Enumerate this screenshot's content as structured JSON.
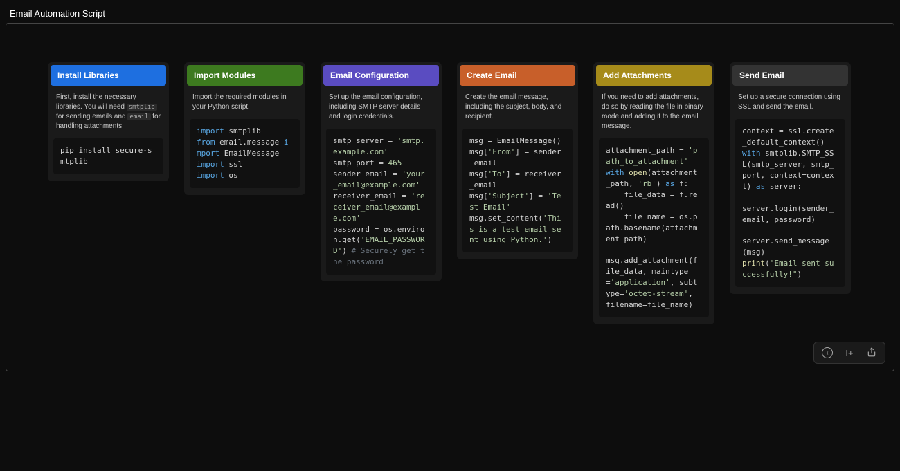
{
  "page_title": "Email Automation Script",
  "cards": [
    {
      "header_class": "hdr-blue",
      "title": "Install Libraries",
      "desc_html": "First, install the necessary libraries. You will need <code>smtplib</code> for sending emails and <code>email</code> for handling attachments.",
      "code_html": "pip install secure-smtplib"
    },
    {
      "header_class": "hdr-green",
      "title": "Import Modules",
      "desc_html": "Import the required modules in your Python script.",
      "code_html": "<span class=\"tok-kw\">import</span> smtplib\n<span class=\"tok-kw\">from</span> email.message <span class=\"tok-kw\">import</span> EmailMessage\n<span class=\"tok-kw\">import</span> ssl\n<span class=\"tok-kw\">import</span> os"
    },
    {
      "header_class": "hdr-purple",
      "title": "Email Configuration",
      "desc_html": "Set up the email configuration, including SMTP server details and login credentials.",
      "code_html": "smtp_server = <span class=\"tok-str\">'smtp.example.com'</span>\nsmtp_port = <span class=\"tok-num\">465</span>\nsender_email = <span class=\"tok-str\">'your_email@example.com'</span>\nreceiver_email = <span class=\"tok-str\">'receiver_email@example.com'</span>\npassword = os.environ.get(<span class=\"tok-str\">'EMAIL_PASSWORD'</span>) <span class=\"tok-cmt\"># Securely get the password</span>"
    },
    {
      "header_class": "hdr-orange",
      "title": "Create Email",
      "desc_html": "Create the email message, including the subject, body, and recipient.",
      "code_html": "msg = EmailMessage()\nmsg[<span class=\"tok-str\">'From'</span>] = sender_email\nmsg[<span class=\"tok-str\">'To'</span>] = receiver_email\nmsg[<span class=\"tok-str\">'Subject'</span>] = <span class=\"tok-str\">'Test Email'</span>\nmsg.set_content(<span class=\"tok-str\">'This is a test email sent using Python.'</span>)"
    },
    {
      "header_class": "hdr-olive",
      "title": "Add Attachments",
      "desc_html": "If you need to add attachments, do so by reading the file in binary mode and adding it to the email message.",
      "code_html": "attachment_path = <span class=\"tok-str\">'path_to_attachment'</span>\n<span class=\"tok-kw\">with</span> <span class=\"tok-fn\">open</span>(attachment_path, <span class=\"tok-str\">'rb'</span>) <span class=\"tok-kw\">as</span> f:\n    file_data = f.read()\n    file_name = os.path.basename(attachment_path)\n\nmsg.add_attachment(file_data, maintype=<span class=\"tok-str\">'application'</span>, subtype=<span class=\"tok-str\">'octet-stream'</span>, filename=file_name)"
    },
    {
      "header_class": "hdr-gray",
      "title": "Send Email",
      "desc_html": "Set up a secure connection using SSL and send the email.",
      "code_html": "context = ssl.create_default_context()\n<span class=\"tok-kw\">with</span> smtplib.SMTP_SSL(smtp_server, smtp_port, context=context) <span class=\"tok-kw\">as</span> server:\n\nserver.login(sender_email, password)\n\nserver.send_message(msg)\n<span class=\"tok-fn\">print</span>(<span class=\"tok-str\">\"Email sent successfully!\"</span>)"
    }
  ],
  "toolbar": {
    "back_label": "‹",
    "step_label": "I+",
    "share_label": "⇪"
  }
}
